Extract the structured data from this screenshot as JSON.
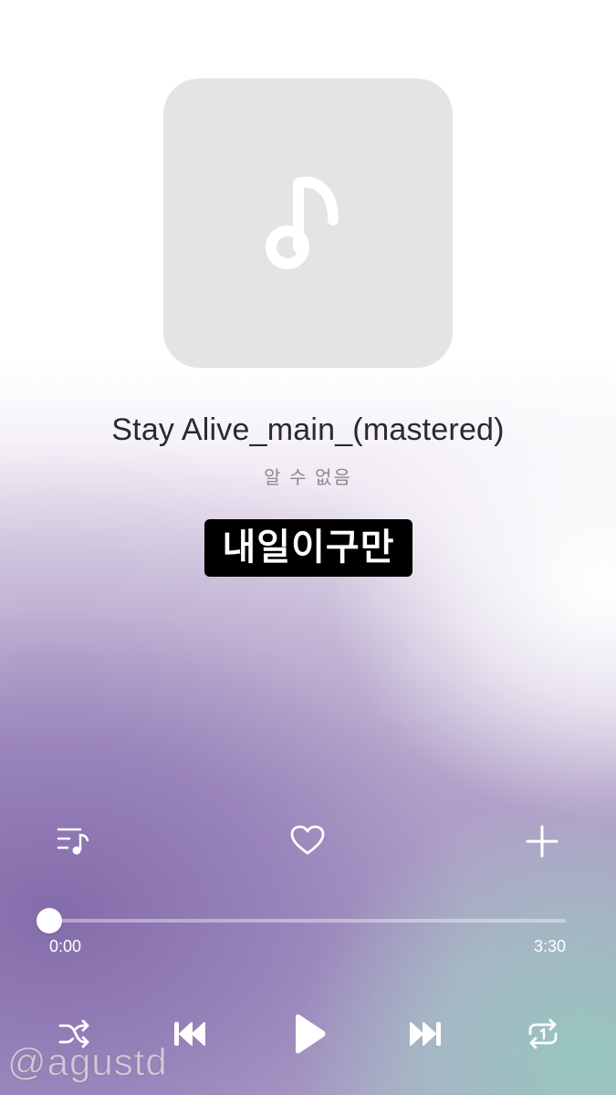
{
  "song": {
    "title": "Stay Alive_main_(mastered)",
    "artist": "알 수 없음"
  },
  "caption": "내일이구만",
  "album_art": {
    "icon": "music-note-icon",
    "background": "#e4e4e6"
  },
  "actions": {
    "playlist_icon": "playlist-icon",
    "favorite_icon": "heart-icon",
    "add_icon": "plus-icon"
  },
  "progress": {
    "elapsed": "0:00",
    "duration": "3:30",
    "fraction": 0.0
  },
  "controls": {
    "shuffle_icon": "shuffle-icon",
    "previous_icon": "skip-previous-icon",
    "play_icon": "play-icon",
    "next_icon": "skip-next-icon",
    "repeat_icon": "repeat-one-icon"
  },
  "watermark": "@agustd",
  "colors": {
    "purple": "#8a72b0",
    "teal": "#9ccbbf",
    "icon": "#ffffff"
  }
}
